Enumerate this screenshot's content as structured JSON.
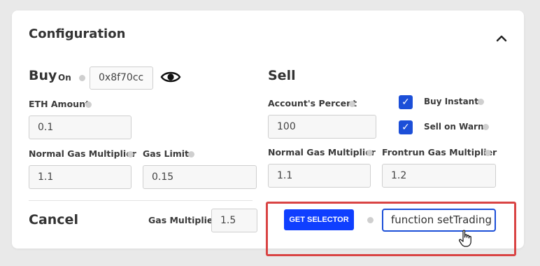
{
  "panel": {
    "title": "Configuration",
    "toggle_icon": "chevron-up-icon"
  },
  "buy": {
    "heading": "Buy",
    "status": "On",
    "address": "0x8f70cc",
    "eye_icon": "eye-icon",
    "eth_amount_label": "ETH Amount",
    "eth_amount_value": "0.1",
    "normal_gas_label": "Normal Gas Multiplier",
    "normal_gas_value": "1.1",
    "gas_limit_label": "Gas Limit",
    "gas_limit_value": "0.15"
  },
  "sell": {
    "heading": "Sell",
    "accounts_percent_label": "Account's Percent",
    "accounts_percent_value": "100",
    "buy_instant_label": "Buy Instant",
    "buy_instant_checked": true,
    "sell_on_warn_label": "Sell on Warn",
    "sell_on_warn_checked": true,
    "normal_gas_label": "Normal Gas Multiplier",
    "normal_gas_value": "1.1",
    "frontrun_gas_label": "Frontrun Gas Multiplier",
    "frontrun_gas_value": "1.2"
  },
  "cancel": {
    "heading": "Cancel",
    "gas_multiplier_label": "Gas Multiplier",
    "gas_multiplier_value": "1.5"
  },
  "selector": {
    "button_label": "GET SELECTOR",
    "function_value": "function setTrading"
  },
  "colors": {
    "accent": "#1c4fd8",
    "button": "#0f3fff",
    "highlight": "#d94444"
  }
}
